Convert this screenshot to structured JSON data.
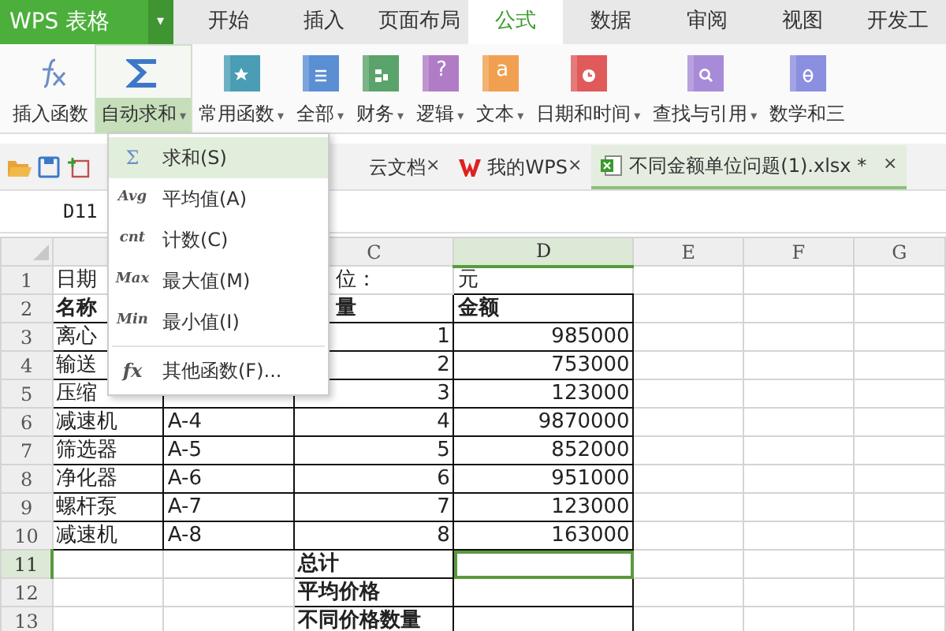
{
  "app_menu": {
    "label": "WPS 表格",
    "caret": "▾"
  },
  "tabs": [
    {
      "label": "开始",
      "selected": false
    },
    {
      "label": "插入",
      "selected": false
    },
    {
      "label": "页面布局",
      "selected": false
    },
    {
      "label": "公式",
      "selected": true
    },
    {
      "label": "数据",
      "selected": false
    },
    {
      "label": "审阅",
      "selected": false
    },
    {
      "label": "视图",
      "selected": false
    },
    {
      "label": "开发工",
      "selected": false
    }
  ],
  "ribbon": [
    {
      "label": "插入函数",
      "selected": false
    },
    {
      "label": "自动求和",
      "caret": "▾",
      "selected": true
    },
    {
      "label": "常用函数",
      "color": "#4a9db5",
      "caret": "▾",
      "selected": false
    },
    {
      "label": "全部",
      "color": "#5b8fd4",
      "caret": "▾",
      "selected": false
    },
    {
      "label": "财务",
      "color": "#5aa36a",
      "caret": "▾",
      "selected": false
    },
    {
      "label": "逻辑",
      "color": "#b07cc6",
      "glyph": "?",
      "caret": "▾",
      "selected": false
    },
    {
      "label": "文本",
      "color": "#f0a050",
      "glyph": "a",
      "caret": "▾",
      "selected": false
    },
    {
      "label": "日期和时间",
      "color": "#e05a5a",
      "caret": "▾",
      "selected": false
    },
    {
      "label": "查找与引用",
      "color": "#a78bd8",
      "caret": "▾",
      "selected": false
    },
    {
      "label": "数学和三",
      "color": "#8a8fe0",
      "selected": false
    }
  ],
  "doc_tabs": [
    {
      "label": "云文档",
      "close": "×",
      "selected": false
    },
    {
      "label": "我的WPS",
      "close": "×",
      "selected": false
    },
    {
      "label": "不同金额单位问题(1).xlsx *",
      "close": "×",
      "selected": true
    }
  ],
  "name_box": "D11",
  "columns": [
    {
      "label": "C",
      "selected": false
    },
    {
      "label": "D",
      "selected": true
    },
    {
      "label": "E",
      "selected": false
    },
    {
      "label": "F",
      "selected": false
    },
    {
      "label": "G",
      "selected": false
    }
  ],
  "rows": [
    {
      "number": "1",
      "kind": "title",
      "selected": false,
      "column_a": "日期",
      "column_c": "位：",
      "column_d": "元"
    },
    {
      "number": "2",
      "kind": "header",
      "selected": false,
      "column_a": "名称",
      "column_c": "量",
      "column_d": "金额"
    },
    {
      "number": "3",
      "kind": "data",
      "selected": false,
      "column_a": "离心",
      "column_c": "1",
      "column_d": "985000"
    },
    {
      "number": "4",
      "kind": "data",
      "selected": false,
      "column_a": "输送",
      "column_c": "2",
      "column_d": "753000"
    },
    {
      "number": "5",
      "kind": "data",
      "selected": false,
      "column_a": "压缩",
      "column_c": "3",
      "column_d": "123000"
    },
    {
      "number": "6",
      "kind": "data",
      "selected": false,
      "column_a": "减速机",
      "column_b": "A-4",
      "column_c": "4",
      "column_d": "9870000"
    },
    {
      "number": "7",
      "kind": "data",
      "selected": false,
      "column_a": "筛选器",
      "column_b": "A-5",
      "column_c": "5",
      "column_d": "852000"
    },
    {
      "number": "8",
      "kind": "data",
      "selected": false,
      "column_a": "净化器",
      "column_b": "A-6",
      "column_c": "6",
      "column_d": "951000"
    },
    {
      "number": "9",
      "kind": "data",
      "selected": false,
      "column_a": "螺杆泵",
      "column_b": "A-7",
      "column_c": "7",
      "column_d": "123000"
    },
    {
      "number": "10",
      "kind": "data",
      "selected": false,
      "column_a": "减速机",
      "column_b": "A-8",
      "column_c": "8",
      "column_d": "163000"
    },
    {
      "number": "11",
      "kind": "summary",
      "selected": true,
      "column_c": "总计"
    },
    {
      "number": "12",
      "kind": "summary",
      "selected": false,
      "column_c": "平均价格"
    },
    {
      "number": "13",
      "kind": "summary",
      "selected": false,
      "column_c": "不同价格数量"
    }
  ],
  "dropdown": [
    {
      "icon_text": "Σ",
      "label": "求和(S)",
      "selected": true,
      "separator_before": false
    },
    {
      "icon_text": "Avg",
      "label": "平均值(A)",
      "selected": false,
      "separator_before": false
    },
    {
      "icon_text": "cnt",
      "label": "计数(C)",
      "selected": false,
      "separator_before": false
    },
    {
      "icon_text": "Max",
      "label": "最大值(M)",
      "selected": false,
      "separator_before": false
    },
    {
      "icon_text": "Min",
      "label": "最小值(I)",
      "selected": false,
      "separator_before": false
    },
    {
      "icon_text": "fx",
      "label": "其他函数(F)...",
      "selected": false,
      "separator_before": true
    }
  ]
}
